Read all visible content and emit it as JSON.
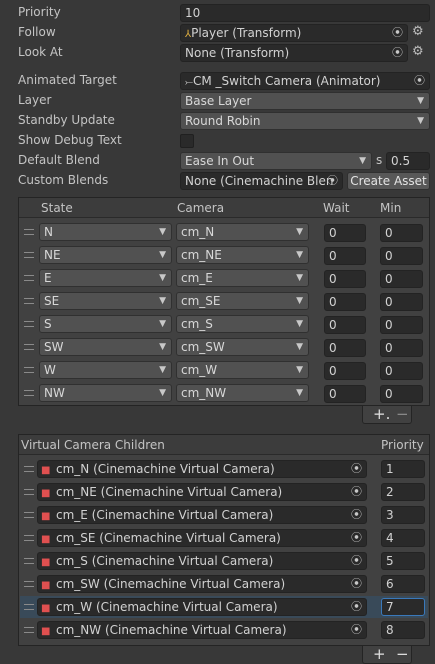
{
  "fields": {
    "priority_label": "Priority",
    "priority_value": "10",
    "follow_label": "Follow",
    "follow_value": "Player (Transform)",
    "lookat_label": "Look At",
    "lookat_value": "None (Transform)",
    "animated_target_label": "Animated Target",
    "animated_target_value": "CM _Switch Camera (Animator)",
    "layer_label": "Layer",
    "layer_value": "Base Layer",
    "standby_label": "Standby Update",
    "standby_value": "Round Robin",
    "debug_label": "Show Debug Text",
    "default_blend_label": "Default Blend",
    "default_blend_value": "Ease In Out",
    "blend_unit": "s",
    "blend_time": "0.5",
    "custom_blends_label": "Custom Blends",
    "custom_blends_value": "None (Cinemachine Blen",
    "create_asset_label": "Create Asset"
  },
  "state_table": {
    "headers": [
      "State",
      "Camera",
      "Wait",
      "Min"
    ],
    "rows": [
      {
        "state": "N",
        "camera": "cm_N",
        "wait": "0",
        "min": "0"
      },
      {
        "state": "NE",
        "camera": "cm_NE",
        "wait": "0",
        "min": "0"
      },
      {
        "state": "E",
        "camera": "cm_E",
        "wait": "0",
        "min": "0"
      },
      {
        "state": "SE",
        "camera": "cm_SE",
        "wait": "0",
        "min": "0"
      },
      {
        "state": "S",
        "camera": "cm_S",
        "wait": "0",
        "min": "0"
      },
      {
        "state": "SW",
        "camera": "cm_SW",
        "wait": "0",
        "min": "0"
      },
      {
        "state": "W",
        "camera": "cm_W",
        "wait": "0",
        "min": "0"
      },
      {
        "state": "NW",
        "camera": "cm_NW",
        "wait": "0",
        "min": "0"
      }
    ],
    "add_label": "+.",
    "remove_label": "−"
  },
  "children": {
    "header": "Virtual Camera Children",
    "priority_header": "Priority",
    "rows": [
      {
        "name": "cm_N (Cinemachine Virtual Camera)",
        "priority": "1"
      },
      {
        "name": "cm_NE (Cinemachine Virtual Camera)",
        "priority": "2"
      },
      {
        "name": "cm_E (Cinemachine Virtual Camera)",
        "priority": "3"
      },
      {
        "name": "cm_SE (Cinemachine Virtual Camera)",
        "priority": "4"
      },
      {
        "name": "cm_S (Cinemachine Virtual Camera)",
        "priority": "5"
      },
      {
        "name": "cm_SW (Cinemachine Virtual Camera)",
        "priority": "6"
      },
      {
        "name": "cm_W (Cinemachine Virtual Camera)",
        "priority": "7"
      },
      {
        "name": "cm_NW (Cinemachine Virtual Camera)",
        "priority": "8"
      }
    ],
    "selected_index": 6,
    "add_label": "+",
    "remove_label": "−"
  },
  "icons": {
    "object_picker": "object-picker-icon",
    "settings": "gear-icon",
    "dropdown": "chevron-down-icon",
    "camera": "cinemachine-camera-icon",
    "transform": "transform-icon",
    "animator": "animator-icon"
  },
  "colors": {
    "background": "#383838",
    "field": "#2a2a2a",
    "selection": "#2c5d87",
    "focus_border": "#3a79bb"
  }
}
